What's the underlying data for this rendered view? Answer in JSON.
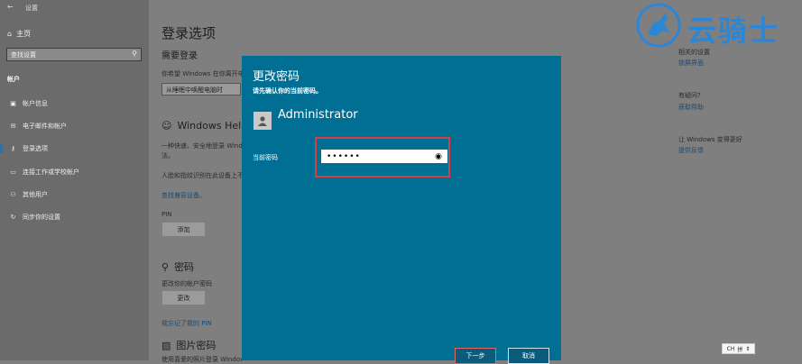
{
  "window": {
    "title": "设置",
    "back": "←"
  },
  "sidebar": {
    "home": "主页",
    "search_placeholder": "查找设置",
    "section": "帐户",
    "items": [
      {
        "label": "帐户信息",
        "icon": "person-card-icon"
      },
      {
        "label": "电子邮件和帐户",
        "icon": "mail-icon"
      },
      {
        "label": "登录选项",
        "icon": "key-icon",
        "active": true
      },
      {
        "label": "连接工作或学校帐户",
        "icon": "briefcase-icon"
      },
      {
        "label": "其他用户",
        "icon": "person-add-icon"
      },
      {
        "label": "同步你的设置",
        "icon": "sync-icon"
      }
    ]
  },
  "main": {
    "title": "登录选项",
    "require_signin": "需要登录",
    "require_desc": "你希望 Windows 在你离开电脑多久后要求你重新登录?",
    "dropdown_value": "从睡眠中唤醒电脑时",
    "hello_title": "Windows Hello",
    "hello_desc1": "一种快速、安全地登录 Windows、应用和服务的方",
    "hello_desc2": "法。",
    "hello_desc3": "人脸和指纹识别在此设备上不可用。",
    "find_compatible": "查找兼容设备。",
    "pin_label": "PIN",
    "add_button": "添加",
    "password_title": "密码",
    "password_desc": "更改你的帐户密码",
    "change_button": "更改",
    "forgot_pin": "我忘记了我的 PIN",
    "picture_password": "图片密码",
    "picture_desc": "使用喜爱的照片登录 Windows"
  },
  "right": {
    "related": "相关的设置",
    "lock_screen": "锁屏界面",
    "have_question": "有疑问?",
    "get_help": "获取帮助",
    "improve": "让 Windows 变得更好",
    "feedback": "提供反馈"
  },
  "dialog": {
    "title": "更改密码",
    "prompt": "请先确认你的当前密码。",
    "username": "Administrator",
    "pw_label": "当前密码",
    "pw_value": "••••••",
    "next": "下一步",
    "cancel": "取消"
  },
  "watermark": {
    "text": "云骑士"
  },
  "ime": {
    "lang": "CH",
    "mode": "拼"
  },
  "colors": {
    "dialog_bg": "#006f93",
    "highlight": "#d6403b",
    "watermark": "#2b86d6"
  }
}
